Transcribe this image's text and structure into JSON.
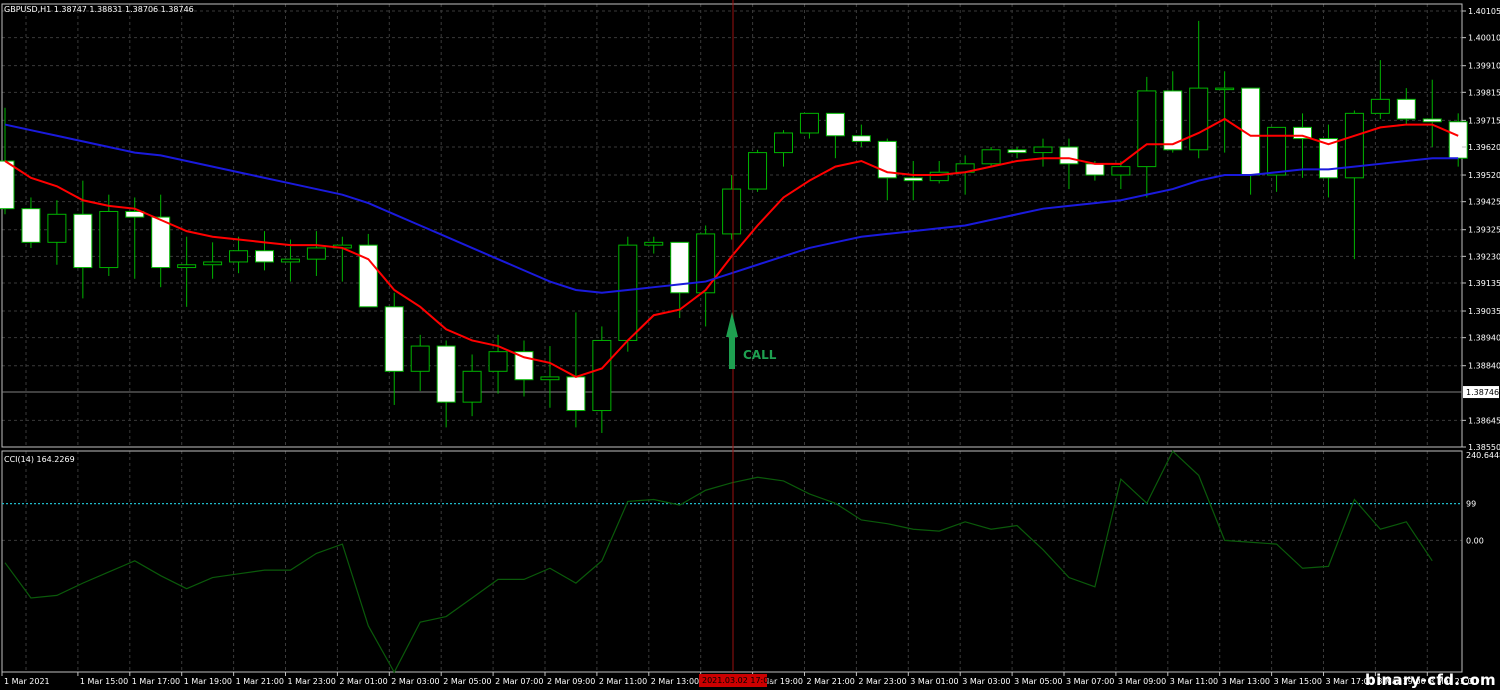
{
  "header": {
    "symbol_info": "GBPUSD,H1  1.38747 1.38831 1.38706 1.38746",
    "indicator_info": "CCI(14) 164.2269"
  },
  "watermark": "binary-cfd.com",
  "colors": {
    "background": "#000000",
    "grid": "#3a3a3a",
    "axis": "#c0c0c0",
    "candle_body_bull": "#000000",
    "candle_body_bear": "#ffffff",
    "candle_outline": "#00b400",
    "ma_fast": "#ff0000",
    "ma_slow": "#1a1adc",
    "cci_line": "#0a5a0a",
    "level_line": "#1fb8c8",
    "cursor_line": "#9a1010",
    "arrow": "#1ea050",
    "price_marker_bg": "#ffffff",
    "time_marker_bg": "#cc0000"
  },
  "annotation": {
    "label": "CALL",
    "icon": "arrow-up-icon"
  },
  "chart_data": [
    {
      "type": "candlestick",
      "title": "GBPUSD,H1",
      "ylim": [
        1.3855,
        1.4013
      ],
      "y_ticks": [
        "1.40105",
        "1.40010",
        "1.39910",
        "1.39815",
        "1.39715",
        "1.39620",
        "1.39520",
        "1.39425",
        "1.39325",
        "1.39230",
        "1.39135",
        "1.39035",
        "1.38940",
        "1.38840",
        "1.38645",
        "1.38550"
      ],
      "current_price": "1.38746",
      "candles": [
        [
          1.3957,
          1.3976,
          1.3938,
          1.394
        ],
        [
          1.394,
          1.3944,
          1.3926,
          1.3928
        ],
        [
          1.3928,
          1.3943,
          1.392,
          1.3938
        ],
        [
          1.3938,
          1.395,
          1.3908,
          1.3919
        ],
        [
          1.3919,
          1.3945,
          1.3916,
          1.3939
        ],
        [
          1.3939,
          1.3944,
          1.3915,
          1.3937
        ],
        [
          1.3937,
          1.3945,
          1.3912,
          1.3919
        ],
        [
          1.3919,
          1.393,
          1.3905,
          1.392
        ],
        [
          1.392,
          1.3928,
          1.3915,
          1.3921
        ],
        [
          1.3921,
          1.393,
          1.3917,
          1.3925
        ],
        [
          1.3925,
          1.3932,
          1.3918,
          1.3921
        ],
        [
          1.3921,
          1.3929,
          1.3914,
          1.3922
        ],
        [
          1.3922,
          1.3932,
          1.3916,
          1.3926
        ],
        [
          1.3926,
          1.393,
          1.3914,
          1.3927
        ],
        [
          1.3927,
          1.3931,
          1.3916,
          1.3905
        ],
        [
          1.3905,
          1.391,
          1.387,
          1.3882
        ],
        [
          1.3882,
          1.3895,
          1.3875,
          1.3891
        ],
        [
          1.3891,
          1.3893,
          1.3862,
          1.3871
        ],
        [
          1.3871,
          1.3888,
          1.3866,
          1.3882
        ],
        [
          1.3882,
          1.3895,
          1.3874,
          1.3889
        ],
        [
          1.3889,
          1.3893,
          1.3873,
          1.3879
        ],
        [
          1.3879,
          1.3891,
          1.3869,
          1.388
        ],
        [
          1.388,
          1.3903,
          1.3862,
          1.3868
        ],
        [
          1.3868,
          1.3898,
          1.386,
          1.3893
        ],
        [
          1.3893,
          1.393,
          1.3889,
          1.3927
        ],
        [
          1.3927,
          1.393,
          1.3924,
          1.3928
        ],
        [
          1.3928,
          1.3928,
          1.3901,
          1.391
        ],
        [
          1.391,
          1.3934,
          1.3898,
          1.3931
        ],
        [
          1.3931,
          1.3952,
          1.3929,
          1.3947
        ],
        [
          1.3947,
          1.3961,
          1.3946,
          1.396
        ],
        [
          1.396,
          1.3968,
          1.3955,
          1.3967
        ],
        [
          1.3967,
          1.3974,
          1.3965,
          1.3974
        ],
        [
          1.3974,
          1.3974,
          1.3958,
          1.3966
        ],
        [
          1.3966,
          1.397,
          1.3962,
          1.3964
        ],
        [
          1.3964,
          1.3965,
          1.3943,
          1.3951
        ],
        [
          1.3951,
          1.3957,
          1.3943,
          1.395
        ],
        [
          1.395,
          1.3957,
          1.3949,
          1.3953
        ],
        [
          1.3953,
          1.3959,
          1.3945,
          1.3956
        ],
        [
          1.3956,
          1.3962,
          1.3955,
          1.3961
        ],
        [
          1.3961,
          1.3962,
          1.3958,
          1.396
        ],
        [
          1.396,
          1.3965,
          1.3955,
          1.3962
        ],
        [
          1.3962,
          1.3965,
          1.3947,
          1.3956
        ],
        [
          1.3956,
          1.3957,
          1.395,
          1.3952
        ],
        [
          1.3952,
          1.3957,
          1.3947,
          1.3955
        ],
        [
          1.3955,
          1.3987,
          1.3944,
          1.3982
        ],
        [
          1.3982,
          1.3989,
          1.396,
          1.3961
        ],
        [
          1.3961,
          1.4007,
          1.3958,
          1.3983
        ],
        [
          1.3983,
          1.3989,
          1.396,
          1.3983
        ],
        [
          1.3983,
          1.3983,
          1.3945,
          1.3952
        ],
        [
          1.3952,
          1.3965,
          1.3946,
          1.3969
        ],
        [
          1.3969,
          1.3974,
          1.3951,
          1.3965
        ],
        [
          1.3965,
          1.397,
          1.3944,
          1.3951
        ],
        [
          1.3951,
          1.3975,
          1.3922,
          1.3974
        ],
        [
          1.3974,
          1.3993,
          1.3972,
          1.3979
        ],
        [
          1.3979,
          1.3983,
          1.397,
          1.3972
        ],
        [
          1.3972,
          1.3986,
          1.3962,
          1.3971
        ],
        [
          1.3971,
          1.3974,
          1.3955,
          1.3958
        ]
      ],
      "series": [
        {
          "color": "#ff0000",
          "values": [
            1.3957,
            1.3951,
            1.3948,
            1.3943,
            1.3941,
            1.394,
            1.3936,
            1.3932,
            1.393,
            1.3929,
            1.3928,
            1.3927,
            1.3927,
            1.3926,
            1.3922,
            1.3911,
            1.3905,
            1.3897,
            1.3893,
            1.3891,
            1.3887,
            1.3885,
            1.388,
            1.3883,
            1.3893,
            1.3902,
            1.3904,
            1.3911,
            1.3923,
            1.3934,
            1.3944,
            1.395,
            1.3955,
            1.3957,
            1.3953,
            1.3952,
            1.3952,
            1.3953,
            1.3955,
            1.3957,
            1.3958,
            1.3958,
            1.3956,
            1.3956,
            1.3963,
            1.3963,
            1.3967,
            1.3972,
            1.3966,
            1.3966,
            1.3966,
            1.3963,
            1.3966,
            1.3969,
            1.397,
            1.397,
            1.3966
          ]
        },
        {
          "color": "#1a1adc",
          "values": [
            1.397,
            1.3968,
            1.3966,
            1.3964,
            1.3962,
            1.396,
            1.3959,
            1.3957,
            1.3955,
            1.3953,
            1.3951,
            1.3949,
            1.3947,
            1.3945,
            1.3942,
            1.3938,
            1.3934,
            1.393,
            1.3926,
            1.3922,
            1.3918,
            1.3914,
            1.3911,
            1.391,
            1.3911,
            1.3912,
            1.3913,
            1.3914,
            1.3917,
            1.392,
            1.3923,
            1.3926,
            1.3928,
            1.393,
            1.3931,
            1.3932,
            1.3933,
            1.3934,
            1.3936,
            1.3938,
            1.394,
            1.3941,
            1.3942,
            1.3943,
            1.3945,
            1.3947,
            1.395,
            1.3952,
            1.3952,
            1.3953,
            1.3954,
            1.3954,
            1.3955,
            1.3956,
            1.3957,
            1.3958,
            1.3958
          ]
        }
      ]
    },
    {
      "type": "line",
      "title": "CCI(14) 164.2269",
      "ylim": [
        -354.284,
        240.6448
      ],
      "y_ticks": [
        "240.6448",
        "99",
        "0.00"
      ],
      "level": 99,
      "values": [
        -60,
        -155,
        -148,
        -115,
        -85,
        -55,
        -95,
        -130,
        -100,
        -90,
        -80,
        -80,
        -35,
        -10,
        -230,
        -355,
        -220,
        -205,
        -155,
        -105,
        -105,
        -75,
        -115,
        -55,
        105,
        110,
        95,
        135,
        155,
        170,
        160,
        125,
        100,
        55,
        45,
        30,
        25,
        50,
        30,
        40,
        -25,
        -100,
        -125,
        165,
        100,
        240,
        175,
        0,
        -5,
        -10,
        -75,
        -70,
        110,
        30,
        50,
        -55
      ]
    }
  ],
  "time_axis": {
    "labels": [
      "1 Mar 2021",
      "1 Mar 15:00",
      "1 Mar 17:00",
      "1 Mar 19:00",
      "1 Mar 21:00",
      "1 Mar 23:00",
      "2 Mar 01:00",
      "2 Mar 03:00",
      "2 Mar 05:00",
      "2 Mar 07:00",
      "2 Mar 09:00",
      "2 Mar 11:00",
      "2 Mar 13:00",
      "2 Mar",
      "2 Mar 19:00",
      "2 Mar 21:00",
      "2 Mar 23:00",
      "3 Mar 01:00",
      "3 Mar 03:00",
      "3 Mar 05:00",
      "3 Mar 07:00",
      "3 Mar 09:00",
      "3 Mar 11:00",
      "3 Mar 13:00",
      "3 Mar 15:00",
      "3 Mar 17:00",
      "3 Mar 19:00",
      "3 Mar 21:00"
    ],
    "cursor_label": "2021.03.02 17:00"
  }
}
